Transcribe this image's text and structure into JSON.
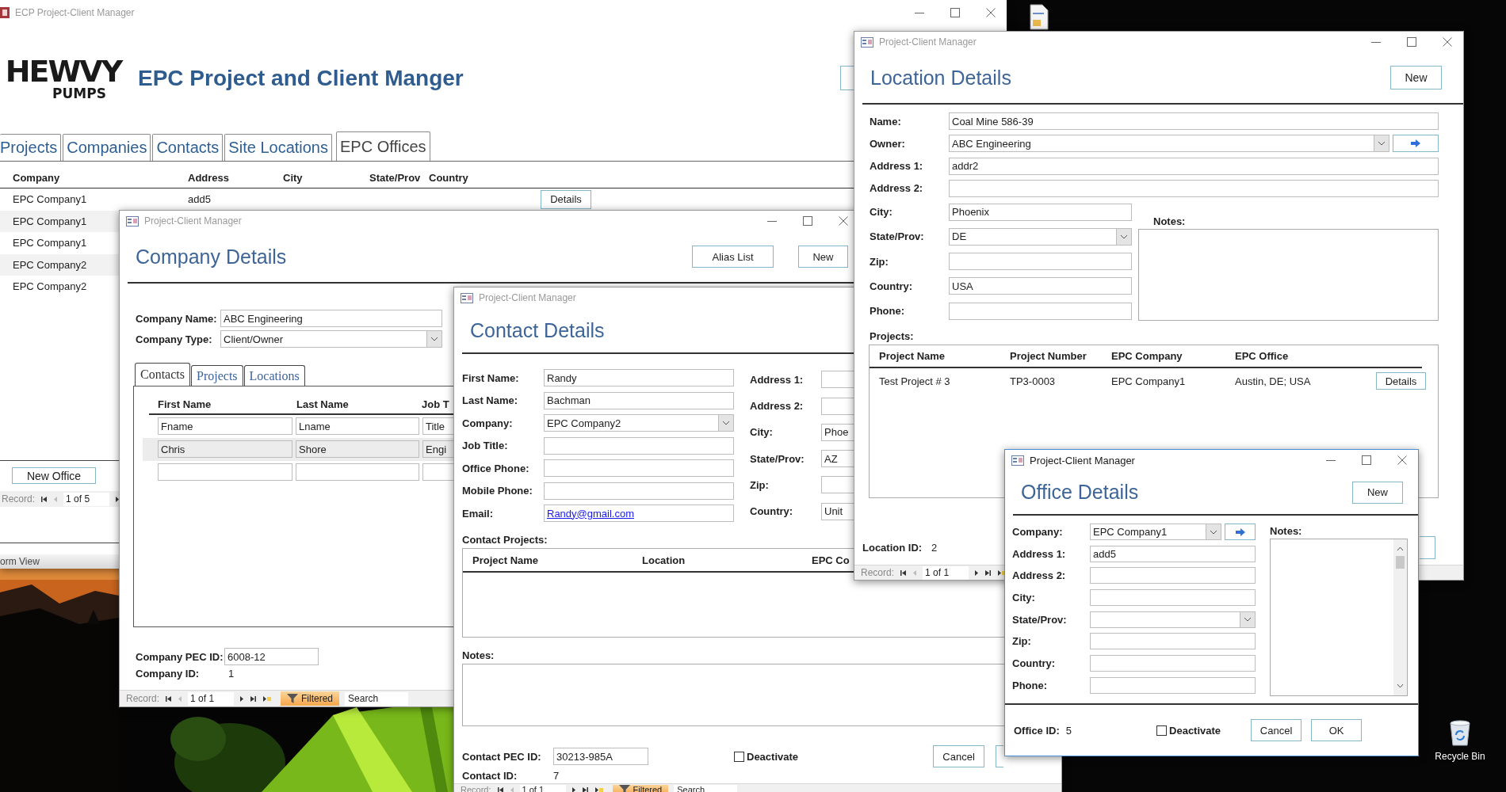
{
  "main_window": {
    "title": "ECP Project-Client Manager",
    "active": false,
    "logo": {
      "word": "HEWVY",
      "subword": "PUMPS"
    },
    "heading": "EPC Project and Client Manger",
    "tabs": [
      {
        "label": "Projects",
        "selected": false
      },
      {
        "label": "Companies",
        "selected": false
      },
      {
        "label": "Contacts",
        "selected": false
      },
      {
        "label": "Site Locations",
        "selected": false
      },
      {
        "label": "EPC Offices",
        "selected": true
      }
    ],
    "table": {
      "columns": [
        "Company",
        "Address",
        "City",
        "State/Prov",
        "Country"
      ],
      "rows": [
        {
          "company": "EPC Company1",
          "address": "add5",
          "action": "Details"
        },
        {
          "company": "EPC Company1"
        },
        {
          "company": "EPC Company1"
        },
        {
          "company": "EPC Company2"
        },
        {
          "company": "EPC Company2"
        }
      ]
    },
    "new_button": "New Office",
    "record_nav": {
      "kind": "short",
      "label": "Record:",
      "position": "1 of 5"
    },
    "status_bar": "orm View"
  },
  "location_window": {
    "title": "Project-Client Manager",
    "active": false,
    "heading": "Location Details",
    "new_button": "New",
    "fields": [
      {
        "label": "Name:",
        "kind": "text",
        "value": "Coal Mine 586-39"
      },
      {
        "label": "Owner:",
        "kind": "dropdown_link",
        "value": "ABC Engineering"
      },
      {
        "label": "Address 1:",
        "kind": "text",
        "value": "addr2"
      },
      {
        "label": "Address 2:",
        "kind": "text"
      }
    ],
    "short_fields": [
      {
        "label": "City:",
        "kind": "text",
        "value": "Phoenix"
      },
      {
        "label": "State/Prov:",
        "kind": "dropdown",
        "value": "DE"
      },
      {
        "label": "Zip:",
        "kind": "text"
      },
      {
        "label": "Country:",
        "kind": "text",
        "value": "USA"
      },
      {
        "label": "Phone:",
        "kind": "text"
      }
    ],
    "notes_label": "Notes:",
    "projects_label": "Projects:",
    "projects_table": {
      "columns": [
        "Project Name",
        "Project Number",
        "EPC Company",
        "EPC Office"
      ],
      "rows": [
        {
          "cells": [
            "Test Project # 3",
            "TP3-0003",
            "EPC Company1",
            "Austin, DE; USA"
          ],
          "action": "Details"
        }
      ]
    },
    "id": {
      "label": "Location ID:",
      "value": "2"
    },
    "record_nav": {
      "kind": "full",
      "label": "Record:",
      "position": "1 of 1"
    }
  },
  "company_window": {
    "title": "Project-Client Manager",
    "active": false,
    "heading": "Company Details",
    "buttons": [
      "Alias List",
      "New"
    ],
    "fields": [
      {
        "label": "Company Name:",
        "kind": "text",
        "value": "ABC Engineering"
      },
      {
        "label": "Company Type:",
        "kind": "dropdown",
        "value": "Client/Owner"
      }
    ],
    "tabs": [
      {
        "label": "Contacts",
        "selected": true
      },
      {
        "label": "Projects",
        "selected": false
      },
      {
        "label": "Locations",
        "selected": false
      }
    ],
    "contacts_table": {
      "columns": [
        "First Name",
        "Last Name",
        "Job T"
      ],
      "rows": [
        {
          "kind": "record",
          "selected": false,
          "cells": [
            "Fname",
            "Lname",
            "Title"
          ]
        },
        {
          "kind": "record",
          "selected": true,
          "cells": [
            "Chris",
            "Shore",
            "Engi"
          ]
        },
        {
          "kind": "new",
          "selected": false
        }
      ]
    },
    "pec_id": {
      "label": "Company PEC ID:",
      "value": "6008-12"
    },
    "id": {
      "label": "Company ID:",
      "value": "1"
    },
    "record_nav": {
      "kind": "full",
      "label": "Record:",
      "position": "1 of 1",
      "filter": "Filtered",
      "search": "Search"
    }
  },
  "contact_window": {
    "title": "Project-Client Manager",
    "active": false,
    "heading": "Contact Details",
    "fields": [
      {
        "label": "First Name:",
        "kind": "text",
        "value": "Randy"
      },
      {
        "label": "Last Name:",
        "kind": "text",
        "value": "Bachman"
      },
      {
        "label": "Company:",
        "kind": "dropdown",
        "value": "EPC Company2"
      },
      {
        "label": "Job Title:",
        "kind": "text"
      },
      {
        "label": "Office Phone:",
        "kind": "text"
      },
      {
        "label": "Mobile Phone:",
        "kind": "text"
      },
      {
        "label": "Email:",
        "kind": "link",
        "value": "Randy@gmail.com"
      }
    ],
    "address_fields": [
      {
        "label": "Address 1:",
        "kind": "text"
      },
      {
        "label": "Address 2:",
        "kind": "text"
      },
      {
        "label": "City:",
        "kind": "text",
        "value": "Phoe"
      },
      {
        "label": "State/Prov:",
        "kind": "text",
        "value": "AZ"
      },
      {
        "label": "Zip:",
        "kind": "text"
      },
      {
        "label": "Country:",
        "kind": "text",
        "value": "Unit"
      }
    ],
    "projects_label": "Contact Projects:",
    "projects_table": {
      "columns": [
        "Project Name",
        "Location",
        "EPC Co"
      ]
    },
    "notes_label": "Notes:",
    "pec_id": {
      "label": "Contact PEC ID:",
      "value": "30213-985A"
    },
    "deactivate": {
      "label": "Deactivate",
      "checked": false
    },
    "cancel_button": "Cancel",
    "id": {
      "label": "Contact ID:",
      "value": "7"
    },
    "record_nav": {
      "kind": "full",
      "label": "Record:",
      "position": "1 of 1",
      "filter": "Filtered",
      "search": "Search"
    }
  },
  "office_window": {
    "title": "Project-Client Manager",
    "active": true,
    "heading": "Office Details",
    "new_button": "New",
    "fields": [
      {
        "label": "Company:",
        "kind": "dropdown_link",
        "value": "EPC Company1"
      },
      {
        "label": "Address 1:",
        "kind": "text",
        "value": "add5"
      },
      {
        "label": "Address 2:",
        "kind": "text"
      },
      {
        "label": "City:",
        "kind": "text"
      },
      {
        "label": "State/Prov:",
        "kind": "dropdown"
      },
      {
        "label": "Zip:",
        "kind": "text"
      },
      {
        "label": "Country:",
        "kind": "text"
      },
      {
        "label": "Phone:",
        "kind": "text"
      }
    ],
    "notes_label": "Notes:",
    "id": {
      "label": "Office ID:",
      "value": "5"
    },
    "deactivate": {
      "label": "Deactivate",
      "checked": false
    },
    "buttons": [
      "Cancel",
      "OK"
    ]
  },
  "desktop": {
    "icons": [
      {
        "kind": "file"
      },
      {
        "kind": "recycle_bin",
        "label": "Recycle Bin"
      }
    ]
  }
}
